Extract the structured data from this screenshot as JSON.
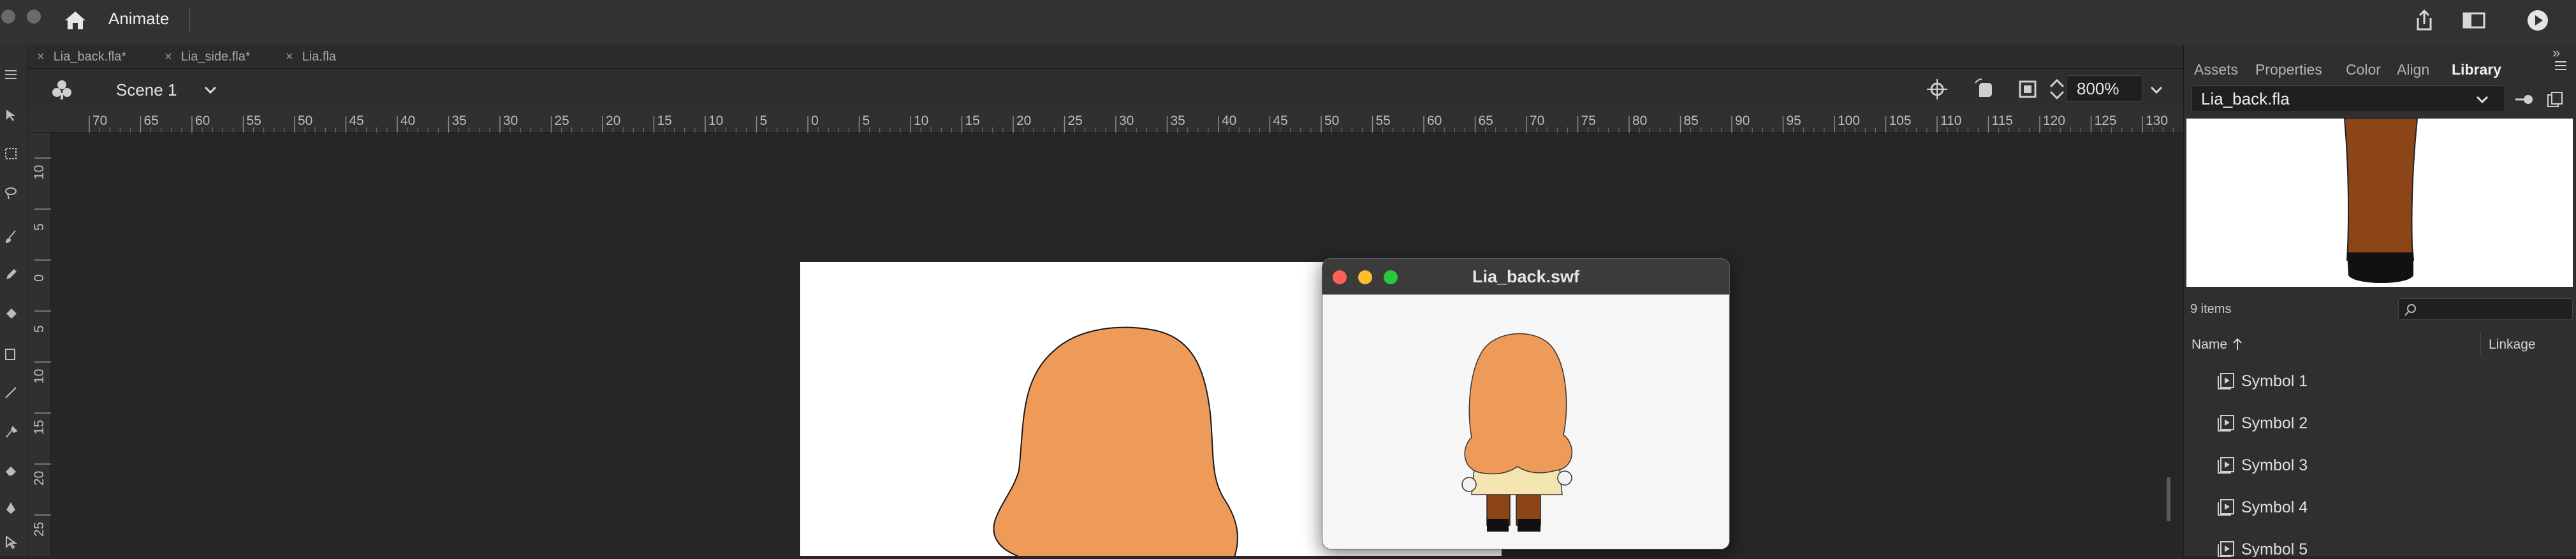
{
  "app": {
    "title": "Animate",
    "icons": [
      "home-icon",
      "share-icon",
      "workspace-icon",
      "play-icon"
    ]
  },
  "tabs": [
    {
      "label": "Lia_back.fla*"
    },
    {
      "label": "Lia_side.fla*"
    },
    {
      "label": "Lia.fla"
    }
  ],
  "editbar": {
    "scene_label": "Scene 1",
    "zoom": "800%",
    "icons": [
      "center-stage-icon",
      "rotate-stage-icon",
      "clip-icon",
      "stepper-icon"
    ]
  },
  "ruler": {
    "h_labels": [
      "70",
      "65",
      "60",
      "55",
      "50",
      "45",
      "40",
      "35",
      "30",
      "25",
      "20",
      "15",
      "10",
      "5",
      "0",
      "5",
      "10",
      "15",
      "20",
      "25",
      "30",
      "35",
      "40",
      "45",
      "50",
      "55",
      "60",
      "65",
      "70",
      "75",
      "80",
      "85",
      "90",
      "95",
      "100",
      "105",
      "110",
      "115",
      "120",
      "125",
      "130"
    ],
    "v_labels": [
      "10",
      "5",
      "0",
      "5",
      "10",
      "15",
      "20",
      "25"
    ]
  },
  "swf_window": {
    "title": "Lia_back.swf",
    "colors": {
      "close": "#ff5f57",
      "minimize": "#febc2e",
      "zoom": "#28c840"
    }
  },
  "library": {
    "tabs": [
      "Assets",
      "Properties",
      "Color",
      "Align",
      "Library"
    ],
    "active_tab": "Library",
    "selected_file": "Lia_back.fla",
    "items_count": "9 items",
    "col_name": "Name",
    "col_linkage": "Linkage",
    "items": [
      {
        "label": "Symbol 1"
      },
      {
        "label": "Symbol 2"
      },
      {
        "label": "Symbol 3"
      },
      {
        "label": "Symbol 4"
      },
      {
        "label": "Symbol 5"
      }
    ]
  },
  "colors": {
    "hair": "#ee9a59",
    "leg": "#8b4518",
    "shirt": "#f4e4b0",
    "shoe": "#111111"
  }
}
